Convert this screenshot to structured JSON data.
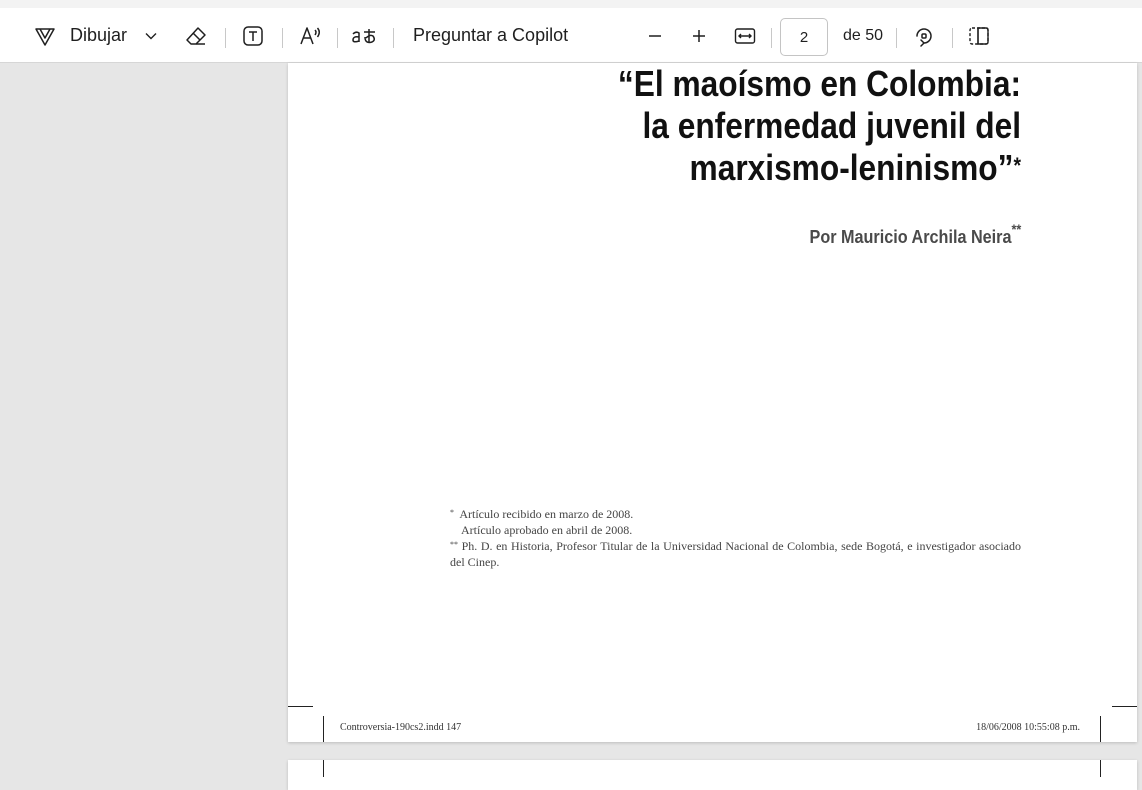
{
  "toolbar": {
    "draw_label": "Dibujar",
    "copilot_label": "Preguntar a Copilot",
    "current_page": "2",
    "page_total": "de 50"
  },
  "document": {
    "title_lines": [
      "“El maoísmo en Colombia:",
      "la enfermedad juvenil del",
      "marxismo-leninismo”"
    ],
    "title_mark": "*",
    "author": "Por Mauricio Archila Neira",
    "author_mark": "**",
    "footnotes": {
      "n1_mark": "*",
      "n1_line1": "Artículo recibido en marzo de 2008.",
      "n1_line2": "Artículo aprobado en abril de 2008.",
      "n2_mark": "**",
      "n2_text": "Ph. D. en Historia, Profesor Titular de la Universidad Nacional de Colombia, sede Bogotá, e investigador asociado del Cinep."
    },
    "footer_left": "Controversia-190cs2.indd   147",
    "footer_right": "18/06/2008   10:55:08 p.m."
  }
}
